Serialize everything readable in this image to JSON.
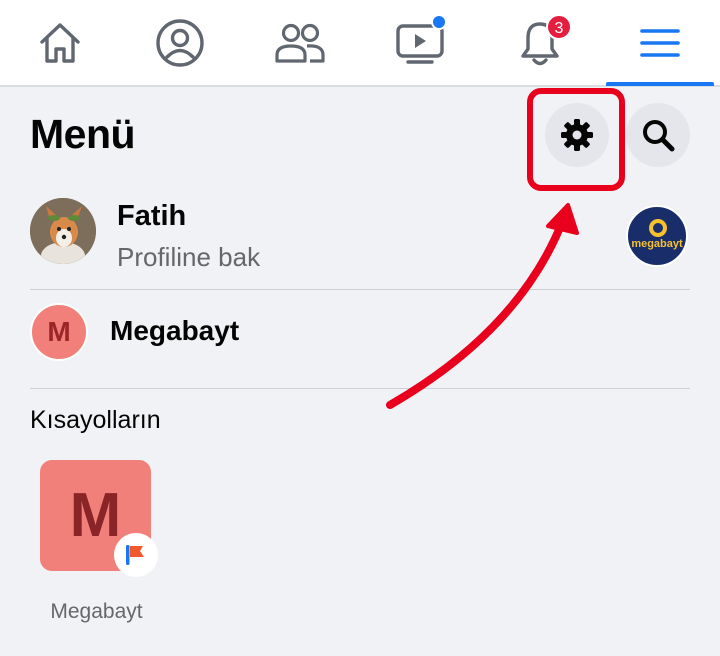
{
  "nav": {
    "items": [
      {
        "name": "home-icon"
      },
      {
        "name": "profile-icon"
      },
      {
        "name": "friends-icon"
      },
      {
        "name": "watch-icon"
      },
      {
        "name": "notifications-icon"
      },
      {
        "name": "menu-icon"
      }
    ],
    "notification_count": "3",
    "active_color": "#1877f2"
  },
  "menu": {
    "title": "Menü"
  },
  "profile": {
    "name": "Fatih",
    "subtitle": "Profiline bak"
  },
  "page_logo": {
    "text": "megabayt"
  },
  "page": {
    "initial": "M",
    "name": "Megabayt"
  },
  "shortcuts": {
    "title": "Kısayolların",
    "items": [
      {
        "initial": "M",
        "label": "Megabayt"
      }
    ]
  },
  "annotation": {
    "color": "#e8001d"
  }
}
